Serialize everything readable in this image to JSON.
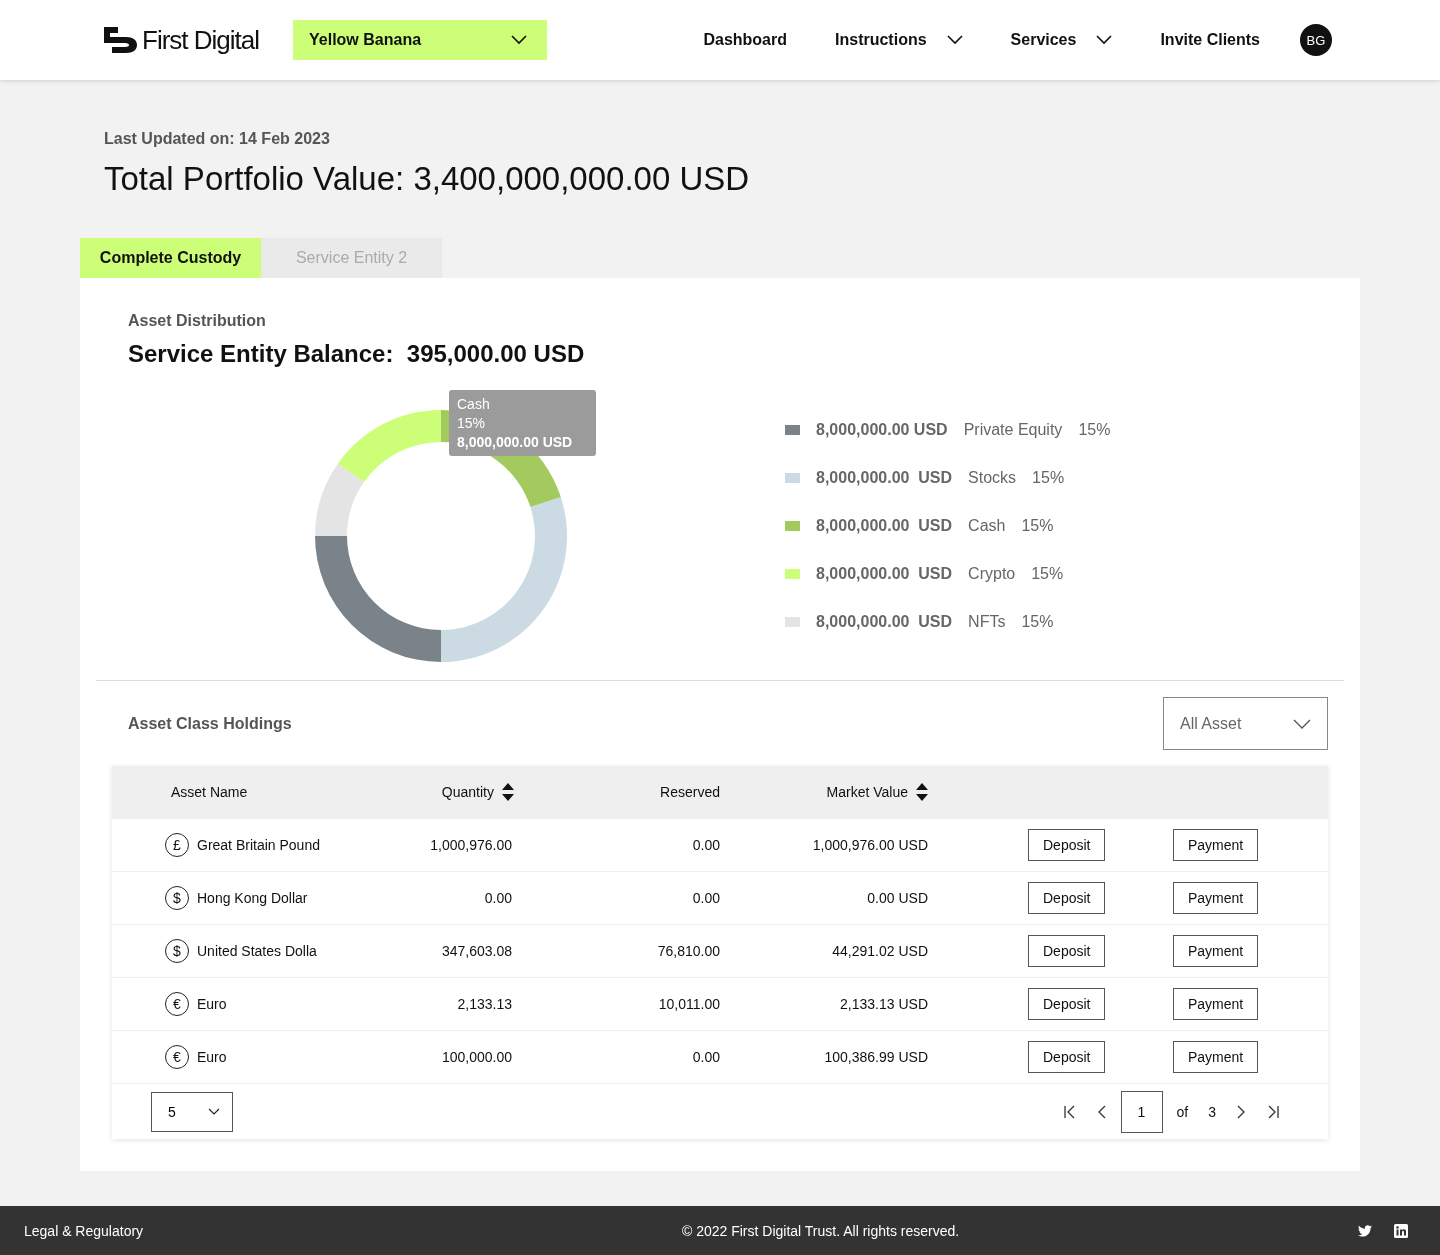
{
  "header": {
    "logo": "First Digital",
    "client_select": "Yellow Banana",
    "nav": [
      {
        "label": "Dashboard",
        "dropdown": false
      },
      {
        "label": "Instructions",
        "dropdown": true
      },
      {
        "label": "Services",
        "dropdown": true
      },
      {
        "label": "Invite Clients",
        "dropdown": false
      }
    ],
    "avatar": "BG"
  },
  "last_updated": "Last Updated on: 14 Feb 2023",
  "total": "Total Portfolio Value: 3,400,000,000.00 USD",
  "tabs": [
    {
      "label": "Complete Custody",
      "selected": true
    },
    {
      "label": "Service Entity 2",
      "selected": false
    }
  ],
  "distribution": {
    "heading": "Asset Distribution",
    "balance": "Service Entity Balance:  395,000.00 USD",
    "tooltip": {
      "name": "Cash",
      "percent": "15%",
      "amount": "8,000,000.00 USD"
    },
    "legend": [
      {
        "amount": "8,000,000.00 USD",
        "name": "Private Equity",
        "percent": "15%",
        "color": "#7b838a"
      },
      {
        "amount": "8,000,000.00  USD",
        "name": "Stocks",
        "percent": "15%",
        "color": "#ccdae3"
      },
      {
        "amount": "8,000,000.00  USD",
        "name": "Cash",
        "percent": "15%",
        "color": "#a2ca5f"
      },
      {
        "amount": "8,000,000.00  USD",
        "name": "Crypto",
        "percent": "15%",
        "color": "#ccff77"
      },
      {
        "amount": "8,000,000.00  USD",
        "name": "NFTs",
        "percent": "15%",
        "color": "#e4e4e4"
      }
    ]
  },
  "holdings": {
    "heading": "Asset Class Holdings",
    "filter": "All Asset",
    "columns": [
      {
        "label": "Asset Name",
        "sortable": false
      },
      {
        "label": "Quantity",
        "sortable": true
      },
      {
        "label": "Reserved",
        "sortable": false
      },
      {
        "label": "Market Value",
        "sortable": true
      }
    ],
    "rows": [
      {
        "symbol": "£",
        "name": "Great Britain Pound",
        "quantity": "1,000,976.00",
        "reserved": "0.00",
        "market_value": "1,000,976.00 USD",
        "deposit": "Deposit",
        "payment": "Payment"
      },
      {
        "symbol": "$",
        "name": "Hong Kong Dollar",
        "quantity": "0.00",
        "reserved": "0.00",
        "market_value": "0.00 USD",
        "deposit": "Deposit",
        "payment": "Payment"
      },
      {
        "symbol": "$",
        "name": "United States Dolla",
        "quantity": "347,603.08",
        "reserved": "76,810.00",
        "market_value": "44,291.02 USD",
        "deposit": "Deposit",
        "payment": "Payment"
      },
      {
        "symbol": "€",
        "name": "Euro",
        "quantity": "2,133.13",
        "reserved": "10,011.00",
        "market_value": "2,133.13 USD",
        "deposit": "Deposit",
        "payment": "Payment"
      },
      {
        "symbol": "€",
        "name": "Euro",
        "quantity": "100,000.00",
        "reserved": "0.00",
        "market_value": "100,386.99 USD",
        "deposit": "Deposit",
        "payment": "Payment"
      }
    ],
    "page_size": "5",
    "page": "1",
    "of": "of",
    "pages": "3"
  },
  "footer": {
    "left": "Legal & Regulatory",
    "copyright": "© 2022 First Digital Trust. All rights reserved."
  }
}
